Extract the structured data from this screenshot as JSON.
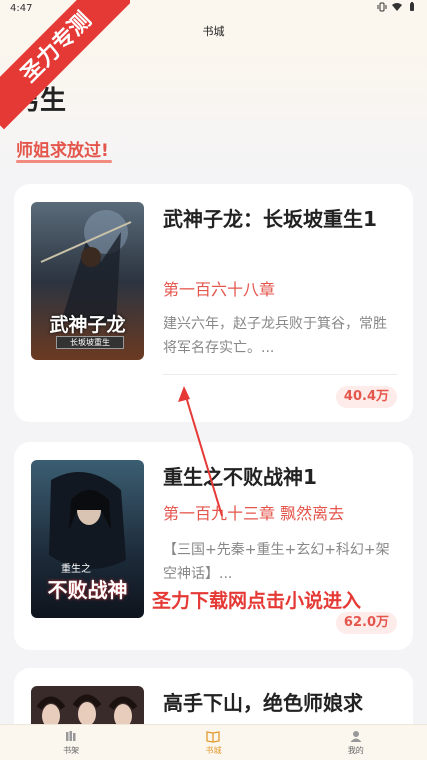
{
  "status_bar": {
    "time": "4:47"
  },
  "header": {
    "title": "书城"
  },
  "watermark": {
    "text": "圣力专测"
  },
  "section": {
    "title": "男生",
    "subtitle": "师姐求放过!"
  },
  "books": [
    {
      "title": "武神子龙：长坂坡重生1",
      "chapter": "第一百六十八章",
      "description": "建兴六年，赵子龙兵败于箕谷，常胜将军名存实亡。...",
      "count": "40.4万",
      "cover_text": "武神子龙",
      "cover_subtext": "长坂坡重生"
    },
    {
      "title": "重生之不败战神1",
      "chapter": "第一百九十三章 飘然离去",
      "description": "【三国+先秦+重生+玄幻+科幻+架空神话】...",
      "count": "62.0万",
      "cover_text": "不败战神",
      "cover_subtext": "重生之"
    },
    {
      "title": "高手下山，绝色师娘求",
      "cover_text": ""
    }
  ],
  "overlay": {
    "caption": "圣力下载网点击小说进入"
  },
  "tabs": [
    {
      "label": "书架",
      "icon": "bookshelf-icon"
    },
    {
      "label": "书城",
      "icon": "book-open-icon"
    },
    {
      "label": "我的",
      "icon": "person-icon"
    }
  ],
  "colors": {
    "accent": "#e4564c",
    "tab_active": "#e39a2d",
    "watermark": "#e53935"
  }
}
